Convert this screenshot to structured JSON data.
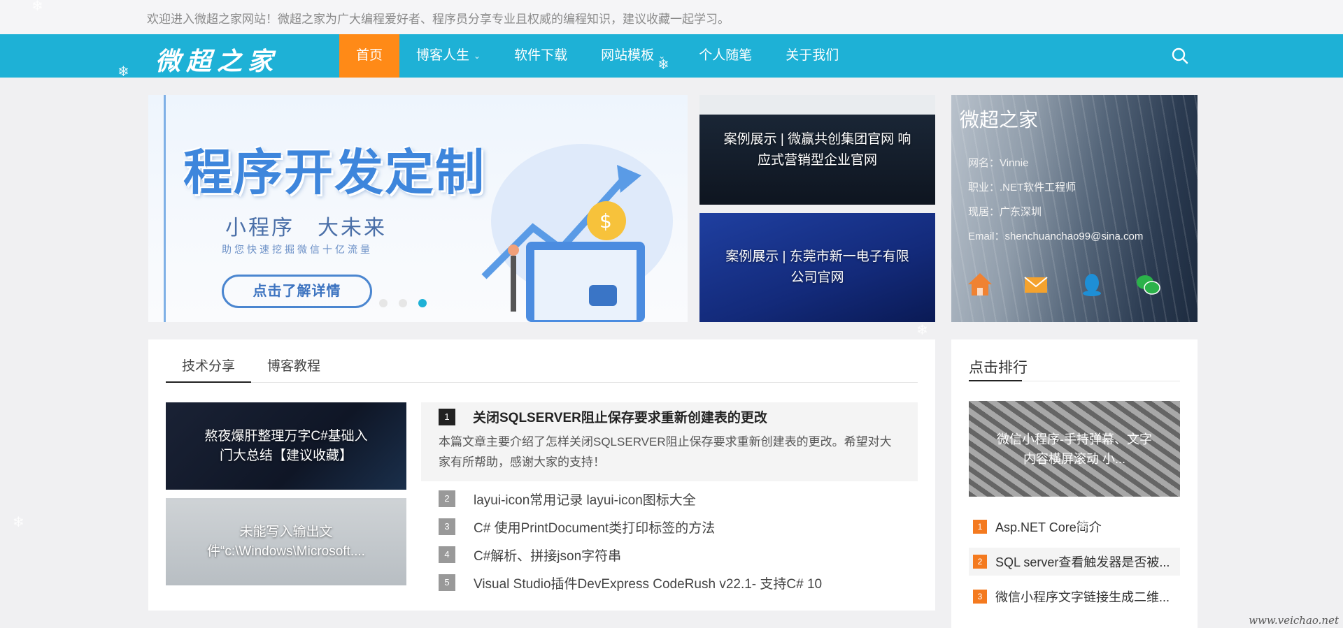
{
  "topbar": {
    "welcome": "欢迎进入微超之家网站！微超之家为广大编程爱好者、程序员分享专业且权威的编程知识，建议收藏一起学习。"
  },
  "nav": {
    "logo": "微超之家",
    "items": [
      {
        "label": "首页",
        "active": true,
        "has_dropdown": false
      },
      {
        "label": "博客人生",
        "active": false,
        "has_dropdown": true
      },
      {
        "label": "软件下载",
        "active": false,
        "has_dropdown": false
      },
      {
        "label": "网站模板",
        "active": false,
        "has_dropdown": true
      },
      {
        "label": "个人随笔",
        "active": false,
        "has_dropdown": false
      },
      {
        "label": "关于我们",
        "active": false,
        "has_dropdown": false
      }
    ],
    "search_icon": "search-icon",
    "bg_color": "#1eb1d6",
    "active_color": "#ff8a17"
  },
  "hero": {
    "headline": "程序开发定制",
    "subtitle": "小程序　大未来",
    "tagline": "助您快速挖掘微信十亿流量",
    "button": "点击了解详情",
    "slides_total": 3,
    "slide_current": 3
  },
  "cases": [
    {
      "caption": "案例展示 | 微赢共创集团官网 响应式营销型企业官网"
    },
    {
      "caption": "案例展示 | 东莞市新一电子有限公司官网"
    }
  ],
  "profile": {
    "title": "微超之家",
    "name": "网名：Vinnie",
    "job": "职业：.NET软件工程师",
    "location": "现居：广东深圳",
    "email": "Email：shenchuanchao99@sina.com",
    "icons": [
      "home-icon",
      "mail-icon",
      "qq-icon",
      "wechat-icon"
    ]
  },
  "articles": {
    "tabs": [
      "技术分享",
      "博客教程"
    ],
    "active_tab": 0,
    "thumbs": [
      {
        "caption": "熬夜爆肝整理万字C#基础入门大总结【建议收藏】"
      },
      {
        "caption": "未能写入输出文件“c:\\Windows\\Microsoft...."
      }
    ],
    "featured": {
      "num": "1",
      "title": "关闭SQLSERVER阻止保存要求重新创建表的更改",
      "desc": "本篇文章主要介绍了怎样关闭SQLSERVER阻止保存要求重新创建表的更改。希望对大家有所帮助，感谢大家的支持！"
    },
    "list": [
      {
        "num": "2",
        "title": "layui-icon常用记录 layui-icon图标大全"
      },
      {
        "num": "3",
        "title": "C# 使用PrintDocument类打印标签的方法"
      },
      {
        "num": "4",
        "title": "C#解析、拼接json字符串"
      },
      {
        "num": "5",
        "title": "Visual Studio插件DevExpress CodeRush v22.1- 支持C# 10"
      }
    ]
  },
  "rank": {
    "heading": "点击排行",
    "image_caption": "微信小程序-手持弹幕、文字内容横屏滚动 小...",
    "items": [
      {
        "num": "1",
        "title": "Asp.NET Core简介"
      },
      {
        "num": "2",
        "title": "SQL server查看触发器是否被..."
      },
      {
        "num": "3",
        "title": "微信小程序文字链接生成二维..."
      }
    ],
    "badge_color": "#f47a1f"
  },
  "watermark": "www.veichao.net"
}
